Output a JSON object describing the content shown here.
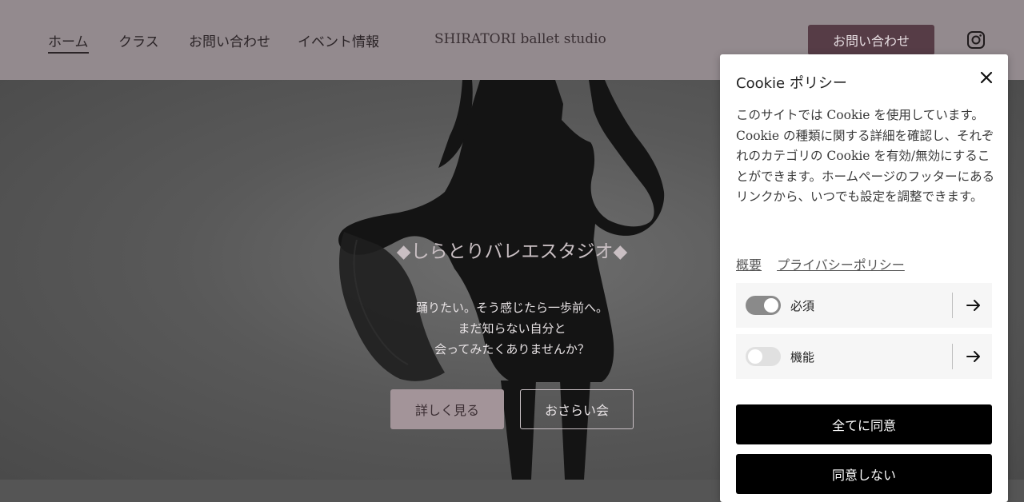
{
  "header": {
    "nav": [
      "ホーム",
      "クラス",
      "お問い合わせ",
      "イベント情報"
    ],
    "brand": "SHIRATORI ballet studio",
    "cta_label": "お問い合わせ",
    "social_icon": "instagram-icon"
  },
  "hero": {
    "title": "◆しらとりバレエスタジオ◆",
    "lines": [
      "踊りたい。そう感じたら一歩前へ。",
      "まだ知らない自分と",
      "会ってみたくありませんか？"
    ],
    "primary_button": "詳しく見る",
    "secondary_button": "おさらい会"
  },
  "cookie": {
    "title": "Cookie ポリシー",
    "body": "このサイトでは Cookie を使用しています。Cookie の種類に関する詳細を確認し、それぞれのカテゴリの Cookie を有効/無効にすることができます。ホームページのフッターにあるリンクから、いつでも設定を調整できます。",
    "links": [
      "概要",
      "プライバシーポリシー"
    ],
    "categories": [
      {
        "label": "必須",
        "enabled": true
      },
      {
        "label": "機能",
        "enabled": false
      }
    ],
    "accept_all": "全てに同意",
    "decline": "同意しない"
  },
  "colors": {
    "header_bg": "#938a8e",
    "cta_bg": "#563c46",
    "primary_button_bg": "#a39499",
    "toggle_on": "#8a8a8a",
    "toggle_off": "#e0e0e0"
  }
}
